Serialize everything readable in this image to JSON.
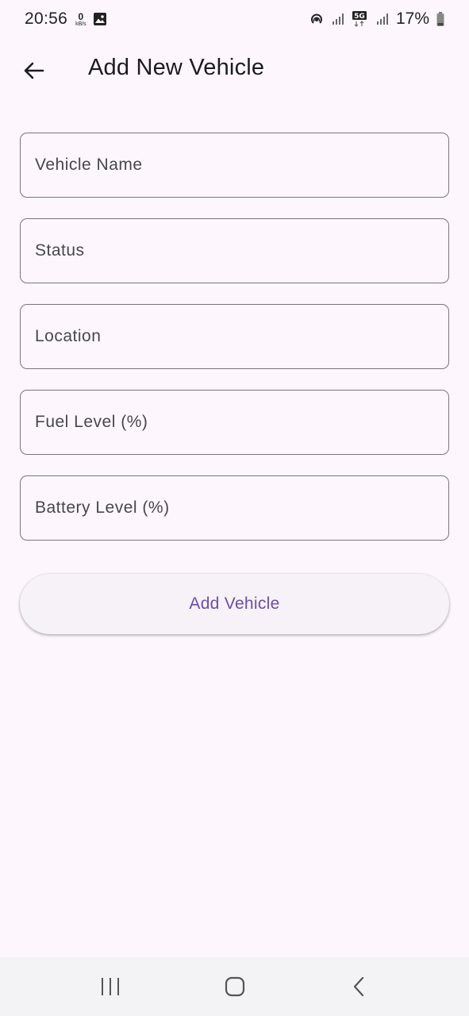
{
  "status_bar": {
    "time": "20:56",
    "net_speed_value": "0",
    "net_speed_unit": "kB/s",
    "battery_percent": "17%",
    "icons": [
      "image-icon",
      "hotspot-icon",
      "signal-icon",
      "5g-icon",
      "signal-icon",
      "battery-icon"
    ]
  },
  "app_bar": {
    "title": "Add New Vehicle",
    "back_icon": "arrow-back-icon"
  },
  "form": {
    "fields": [
      {
        "placeholder": "Vehicle Name",
        "value": ""
      },
      {
        "placeholder": "Status",
        "value": ""
      },
      {
        "placeholder": "Location",
        "value": ""
      },
      {
        "placeholder": "Fuel Level (%)",
        "value": ""
      },
      {
        "placeholder": "Battery Level (%)",
        "value": ""
      }
    ],
    "submit_label": "Add Vehicle"
  },
  "nav_bar": {
    "icons": [
      "recents-icon",
      "home-icon",
      "back-icon"
    ]
  },
  "colors": {
    "background": "#fdf7fd",
    "accent": "#6a4fa5",
    "outline": "#79747e",
    "button_bg": "#f7f1f8",
    "nav_bg": "#f3f3f5"
  }
}
